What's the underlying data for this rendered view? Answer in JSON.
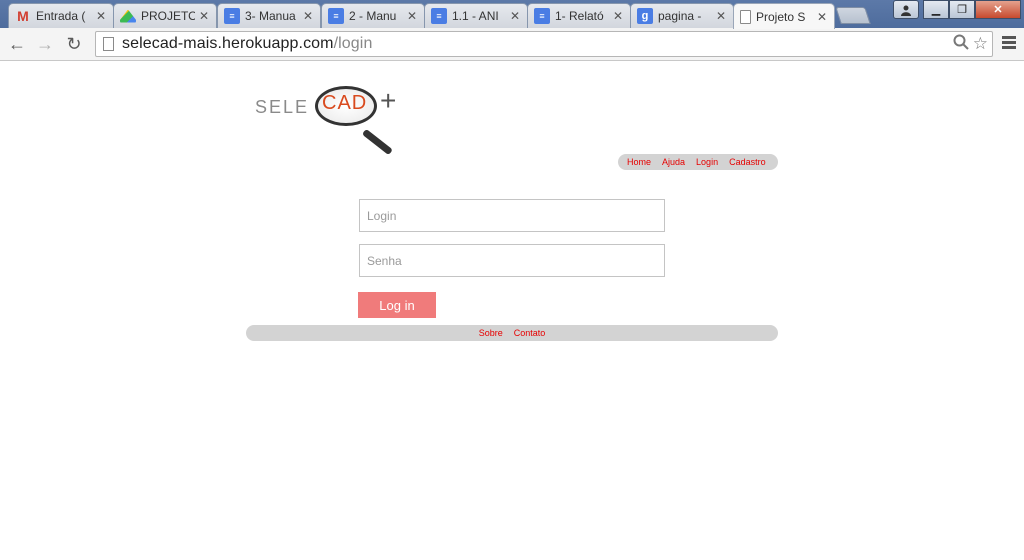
{
  "browser": {
    "tabs": [
      {
        "title": "Entrada (",
        "favicon": "gmail-icon"
      },
      {
        "title": "PROJETO",
        "favicon": "drive-icon"
      },
      {
        "title": "3- Manua",
        "favicon": "docs-icon"
      },
      {
        "title": "2 - Manu",
        "favicon": "docs-icon"
      },
      {
        "title": "1.1 - ANI",
        "favicon": "docs-icon"
      },
      {
        "title": "1- Relató",
        "favicon": "docs-icon"
      },
      {
        "title": "pagina -",
        "favicon": "google-icon"
      },
      {
        "title": "Projeto S",
        "favicon": "page-icon",
        "active": true
      }
    ],
    "url_host": "selecad-mais.herokuapp.com",
    "url_path": "/login",
    "close_glyph": "✕"
  },
  "logo": {
    "sele": "SELE",
    "cad": "CAD",
    "plus": "+"
  },
  "nav": {
    "home": "Home",
    "ajuda": "Ajuda",
    "login": "Login",
    "cadastro": "Cadastro"
  },
  "form": {
    "login_placeholder": "Login",
    "senha_placeholder": "Senha",
    "submit_label": "Log in"
  },
  "footer": {
    "sobre": "Sobre",
    "contato": "Contato"
  },
  "colors": {
    "accent_link": "#e60000",
    "button": "#f07b7b",
    "bar": "#d3d3d3",
    "logo_cad": "#d94a1e"
  }
}
